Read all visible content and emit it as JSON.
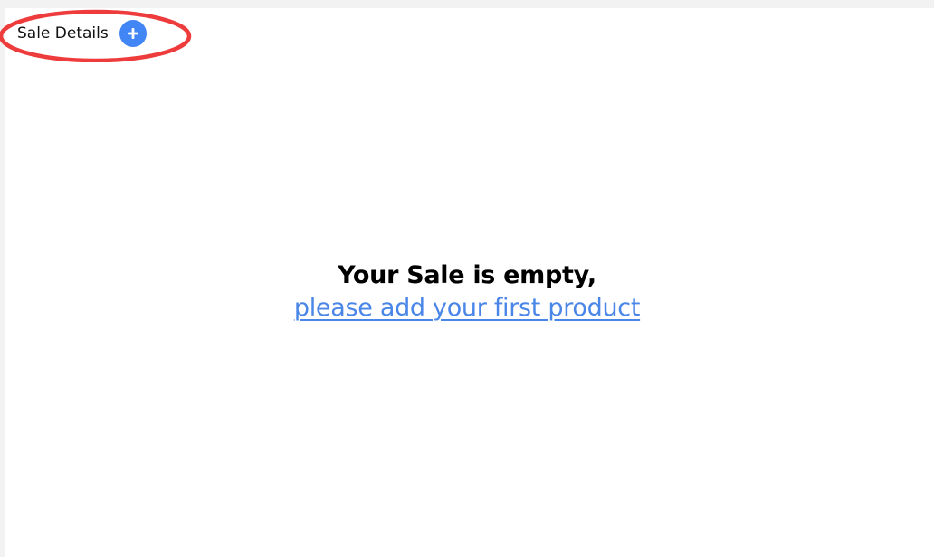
{
  "header": {
    "title": "Sale Details",
    "add_icon": "plus-icon"
  },
  "empty_state": {
    "title": "Your Sale is empty,",
    "link": "please add your first product"
  },
  "colors": {
    "accent": "#4285f4",
    "link": "#4a86e8",
    "annotation": "#ee3b3b",
    "page_background": "#f2f2f2",
    "panel_background": "#ffffff"
  }
}
